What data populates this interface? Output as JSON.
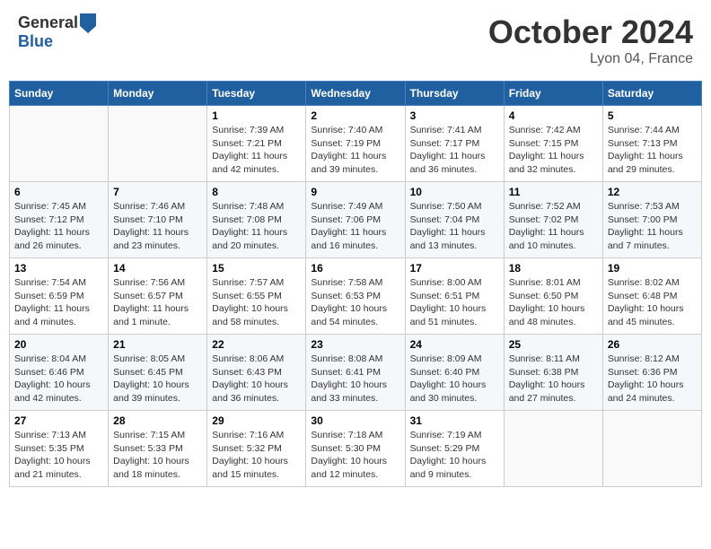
{
  "header": {
    "logo_line1": "General",
    "logo_line2": "Blue",
    "month": "October 2024",
    "location": "Lyon 04, France"
  },
  "weekdays": [
    "Sunday",
    "Monday",
    "Tuesday",
    "Wednesday",
    "Thursday",
    "Friday",
    "Saturday"
  ],
  "weeks": [
    [
      {
        "day": "",
        "info": ""
      },
      {
        "day": "",
        "info": ""
      },
      {
        "day": "1",
        "info": "Sunrise: 7:39 AM\nSunset: 7:21 PM\nDaylight: 11 hours and 42 minutes."
      },
      {
        "day": "2",
        "info": "Sunrise: 7:40 AM\nSunset: 7:19 PM\nDaylight: 11 hours and 39 minutes."
      },
      {
        "day": "3",
        "info": "Sunrise: 7:41 AM\nSunset: 7:17 PM\nDaylight: 11 hours and 36 minutes."
      },
      {
        "day": "4",
        "info": "Sunrise: 7:42 AM\nSunset: 7:15 PM\nDaylight: 11 hours and 32 minutes."
      },
      {
        "day": "5",
        "info": "Sunrise: 7:44 AM\nSunset: 7:13 PM\nDaylight: 11 hours and 29 minutes."
      }
    ],
    [
      {
        "day": "6",
        "info": "Sunrise: 7:45 AM\nSunset: 7:12 PM\nDaylight: 11 hours and 26 minutes."
      },
      {
        "day": "7",
        "info": "Sunrise: 7:46 AM\nSunset: 7:10 PM\nDaylight: 11 hours and 23 minutes."
      },
      {
        "day": "8",
        "info": "Sunrise: 7:48 AM\nSunset: 7:08 PM\nDaylight: 11 hours and 20 minutes."
      },
      {
        "day": "9",
        "info": "Sunrise: 7:49 AM\nSunset: 7:06 PM\nDaylight: 11 hours and 16 minutes."
      },
      {
        "day": "10",
        "info": "Sunrise: 7:50 AM\nSunset: 7:04 PM\nDaylight: 11 hours and 13 minutes."
      },
      {
        "day": "11",
        "info": "Sunrise: 7:52 AM\nSunset: 7:02 PM\nDaylight: 11 hours and 10 minutes."
      },
      {
        "day": "12",
        "info": "Sunrise: 7:53 AM\nSunset: 7:00 PM\nDaylight: 11 hours and 7 minutes."
      }
    ],
    [
      {
        "day": "13",
        "info": "Sunrise: 7:54 AM\nSunset: 6:59 PM\nDaylight: 11 hours and 4 minutes."
      },
      {
        "day": "14",
        "info": "Sunrise: 7:56 AM\nSunset: 6:57 PM\nDaylight: 11 hours and 1 minute."
      },
      {
        "day": "15",
        "info": "Sunrise: 7:57 AM\nSunset: 6:55 PM\nDaylight: 10 hours and 58 minutes."
      },
      {
        "day": "16",
        "info": "Sunrise: 7:58 AM\nSunset: 6:53 PM\nDaylight: 10 hours and 54 minutes."
      },
      {
        "day": "17",
        "info": "Sunrise: 8:00 AM\nSunset: 6:51 PM\nDaylight: 10 hours and 51 minutes."
      },
      {
        "day": "18",
        "info": "Sunrise: 8:01 AM\nSunset: 6:50 PM\nDaylight: 10 hours and 48 minutes."
      },
      {
        "day": "19",
        "info": "Sunrise: 8:02 AM\nSunset: 6:48 PM\nDaylight: 10 hours and 45 minutes."
      }
    ],
    [
      {
        "day": "20",
        "info": "Sunrise: 8:04 AM\nSunset: 6:46 PM\nDaylight: 10 hours and 42 minutes."
      },
      {
        "day": "21",
        "info": "Sunrise: 8:05 AM\nSunset: 6:45 PM\nDaylight: 10 hours and 39 minutes."
      },
      {
        "day": "22",
        "info": "Sunrise: 8:06 AM\nSunset: 6:43 PM\nDaylight: 10 hours and 36 minutes."
      },
      {
        "day": "23",
        "info": "Sunrise: 8:08 AM\nSunset: 6:41 PM\nDaylight: 10 hours and 33 minutes."
      },
      {
        "day": "24",
        "info": "Sunrise: 8:09 AM\nSunset: 6:40 PM\nDaylight: 10 hours and 30 minutes."
      },
      {
        "day": "25",
        "info": "Sunrise: 8:11 AM\nSunset: 6:38 PM\nDaylight: 10 hours and 27 minutes."
      },
      {
        "day": "26",
        "info": "Sunrise: 8:12 AM\nSunset: 6:36 PM\nDaylight: 10 hours and 24 minutes."
      }
    ],
    [
      {
        "day": "27",
        "info": "Sunrise: 7:13 AM\nSunset: 5:35 PM\nDaylight: 10 hours and 21 minutes."
      },
      {
        "day": "28",
        "info": "Sunrise: 7:15 AM\nSunset: 5:33 PM\nDaylight: 10 hours and 18 minutes."
      },
      {
        "day": "29",
        "info": "Sunrise: 7:16 AM\nSunset: 5:32 PM\nDaylight: 10 hours and 15 minutes."
      },
      {
        "day": "30",
        "info": "Sunrise: 7:18 AM\nSunset: 5:30 PM\nDaylight: 10 hours and 12 minutes."
      },
      {
        "day": "31",
        "info": "Sunrise: 7:19 AM\nSunset: 5:29 PM\nDaylight: 10 hours and 9 minutes."
      },
      {
        "day": "",
        "info": ""
      },
      {
        "day": "",
        "info": ""
      }
    ]
  ]
}
